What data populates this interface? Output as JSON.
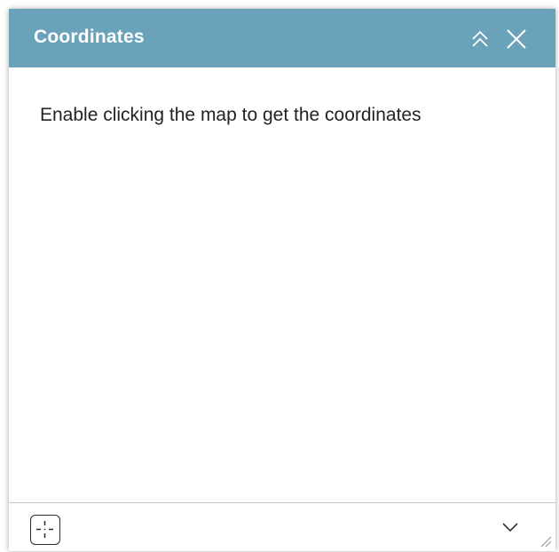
{
  "widget": {
    "title": "Coordinates",
    "message": "Enable clicking the map to get the coordinates",
    "header_color": "#6aa2b9",
    "icons": {
      "collapse": "double-chevron-up-icon",
      "close": "close-icon",
      "locate": "crosshair-icon",
      "expand": "chevron-down-icon",
      "resize": "resize-grip-icon"
    }
  }
}
